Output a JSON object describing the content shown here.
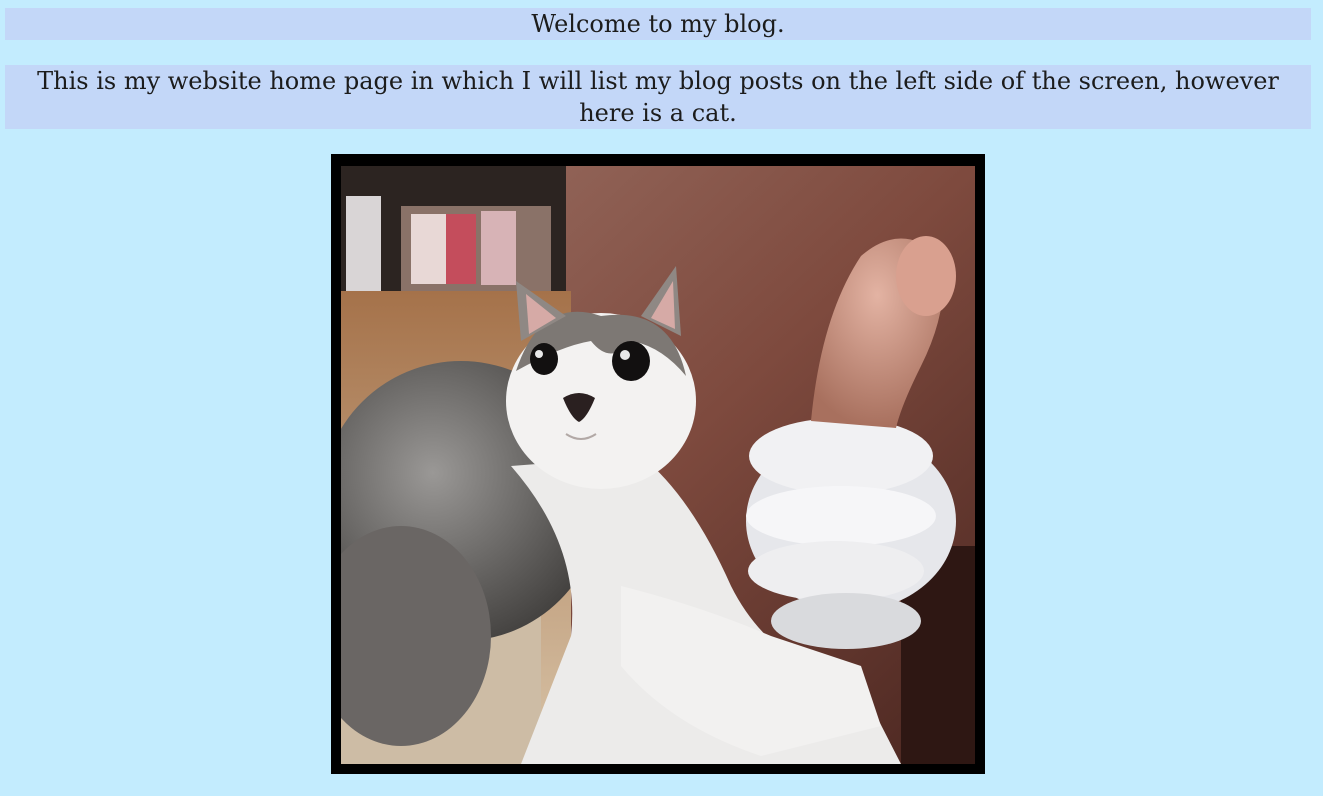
{
  "page": {
    "heading": "Welcome to my blog.",
    "intro": "This is my website home page in which I will list my blog posts on the left side of the screen, however here is a cat."
  },
  "photo": {
    "alt": "a cat giving a thumbs up",
    "icon": "cat-thumbs-up-image"
  },
  "colors": {
    "background": "#c3ecfe",
    "panel": "#c3d7f8",
    "frame": "#000000"
  }
}
